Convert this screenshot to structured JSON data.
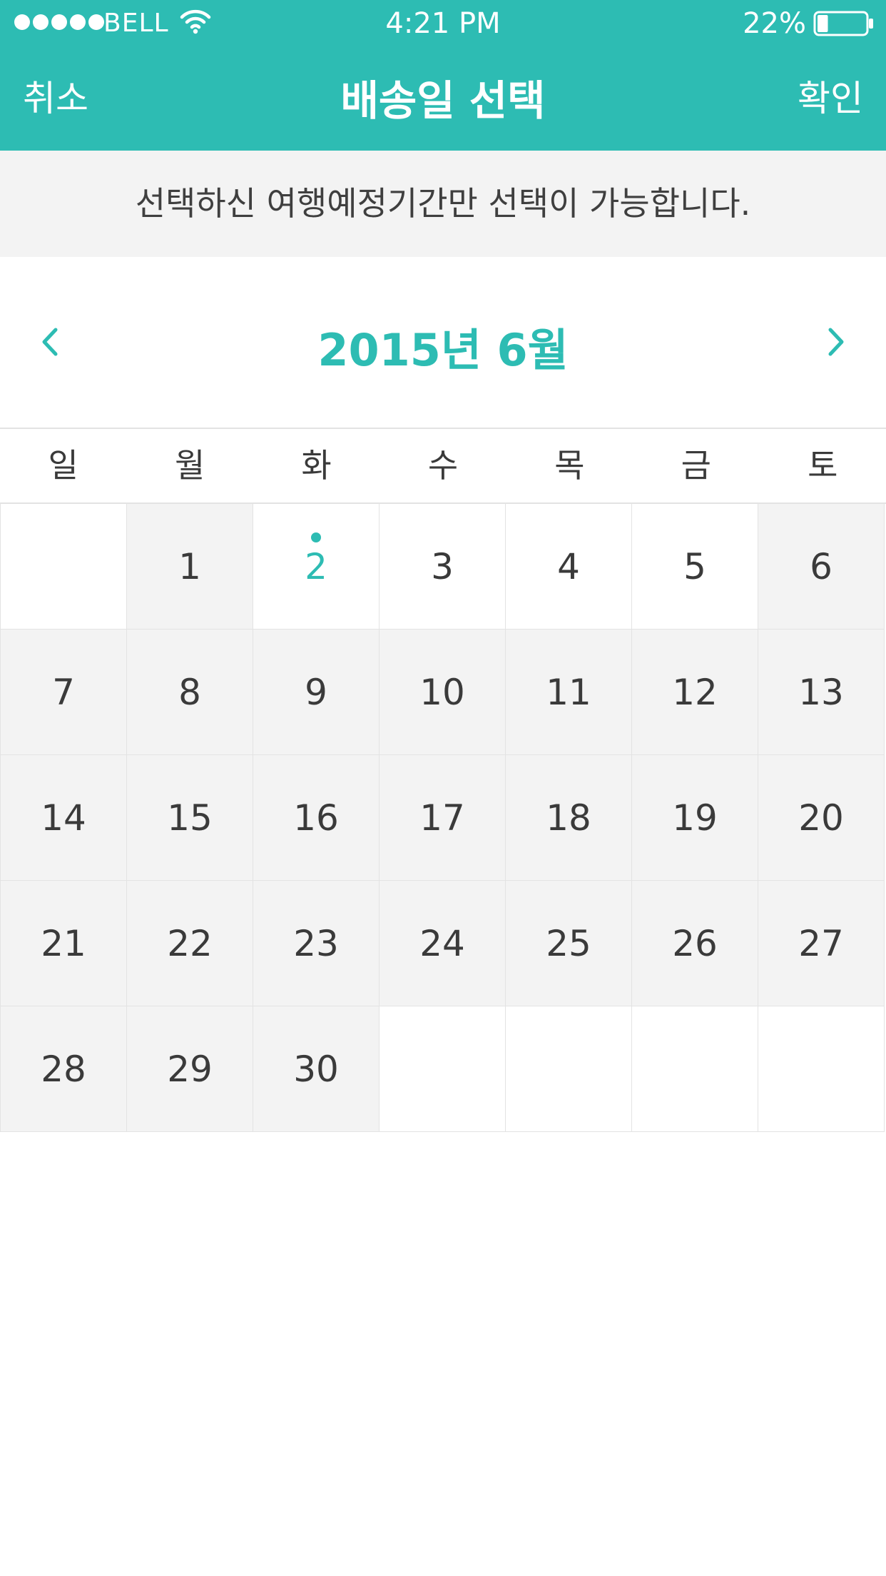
{
  "status_bar": {
    "carrier": "BELL",
    "time": "4:21 PM",
    "battery": "22%",
    "battery_level": 0.22
  },
  "nav": {
    "cancel_label": "취소",
    "title": "배송일 선택",
    "confirm_label": "확인"
  },
  "notice": "선택하신 여행예정기간만 선택이 가능합니다.",
  "calendar": {
    "month_title": "2015년 6월",
    "prev_icon": "chevron-left-icon",
    "next_icon": "chevron-right-icon",
    "weekdays": [
      "일",
      "월",
      "화",
      "수",
      "목",
      "금",
      "토"
    ],
    "accent_color": "#2dbcb3",
    "disabled_color": "#f3f3f3",
    "selected_day": "2",
    "available_days": [
      "2",
      "3",
      "4",
      "5"
    ],
    "weeks": [
      [
        "",
        "1",
        "2",
        "3",
        "4",
        "5",
        "6"
      ],
      [
        "7",
        "8",
        "9",
        "10",
        "11",
        "12",
        "13"
      ],
      [
        "14",
        "15",
        "16",
        "17",
        "18",
        "19",
        "20"
      ],
      [
        "21",
        "22",
        "23",
        "24",
        "25",
        "26",
        "27"
      ],
      [
        "28",
        "29",
        "30",
        "",
        "",
        "",
        ""
      ]
    ]
  }
}
